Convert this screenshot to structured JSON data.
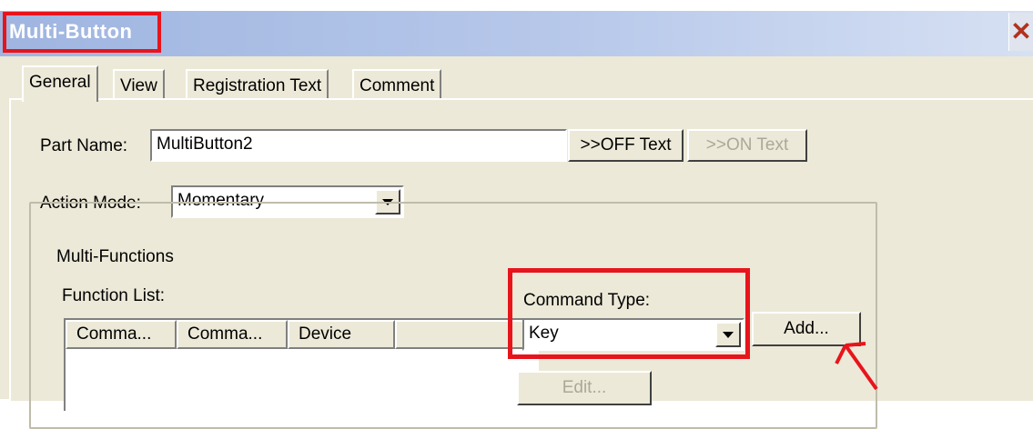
{
  "window": {
    "title": "Multi-Button",
    "close_glyph": "✕"
  },
  "tabs": [
    {
      "label": "General",
      "active": true
    },
    {
      "label": "View",
      "active": false
    },
    {
      "label": "Registration Text",
      "active": false
    },
    {
      "label": "Comment",
      "active": false
    }
  ],
  "part_name": {
    "label": "Part Name:",
    "value": "MultiButton2",
    "off_text_button": ">>OFF Text",
    "on_text_button": ">>ON Text"
  },
  "action_mode": {
    "label": "Action Mode:",
    "value": "Momentary"
  },
  "multi_functions": {
    "group_title": "Multi-Functions",
    "function_list_label": "Function List:",
    "columns": [
      "Comma...",
      "Comma...",
      "Device"
    ],
    "command_type_label": "Command Type:",
    "command_type_value": "Key",
    "add_button": "Add...",
    "edit_button": "Edit..."
  },
  "colors": {
    "highlight": "#e8141c",
    "dialog_bg": "#ece9d8",
    "title_gradient_start": "#9fb5e0"
  }
}
